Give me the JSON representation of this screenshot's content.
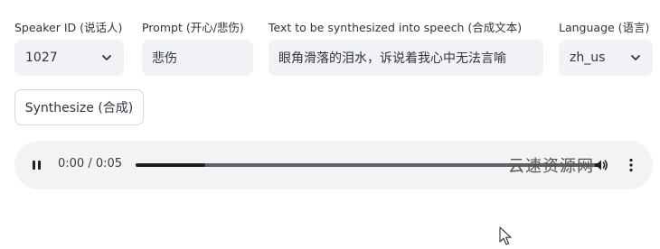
{
  "speaker": {
    "label": "Speaker ID (说话人)",
    "value": "1027"
  },
  "prompt": {
    "label": "Prompt (开心/悲伤)",
    "value": "悲伤"
  },
  "text": {
    "label": "Text to be synthesized into speech (合成文本)",
    "value": "眼角滑落的泪水，诉说着我心中无法言喻"
  },
  "language": {
    "label": "Language (语言)",
    "value": "zh_us"
  },
  "synthesize_button": {
    "label": "Synthesize (合成)"
  },
  "player": {
    "time": "0:00 / 0:05",
    "progress_fraction": 0.15,
    "play_state_icon": "pause-icon"
  },
  "watermark": "云速资源网",
  "colors": {
    "field_bg": "#f0f2f6",
    "player_bg": "#f1f3f4",
    "text": "#31333f"
  }
}
